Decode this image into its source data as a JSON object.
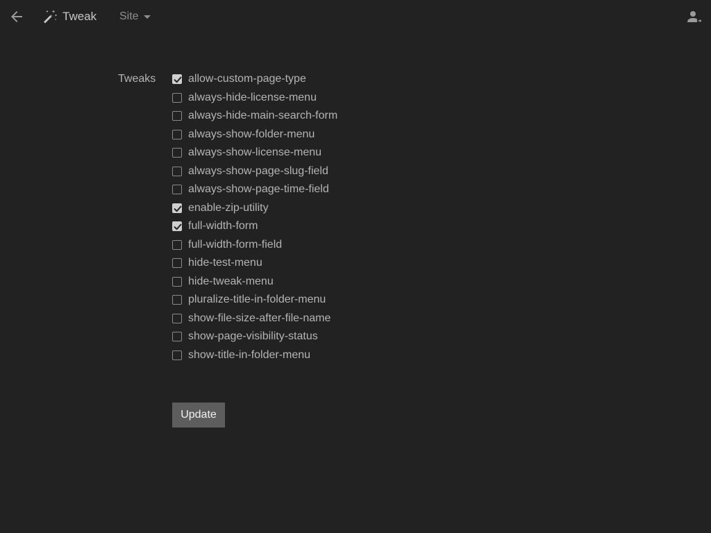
{
  "header": {
    "back_icon": "arrow-left-icon",
    "app_icon": "magic-wand-icon",
    "app_title": "Tweak",
    "site_menu_label": "Site",
    "site_menu_icon": "caret-down-icon",
    "user_icon": "user-account-icon"
  },
  "form": {
    "label": "Tweaks",
    "tweaks": [
      {
        "name": "allow-custom-page-type",
        "checked": true
      },
      {
        "name": "always-hide-license-menu",
        "checked": false
      },
      {
        "name": "always-hide-main-search-form",
        "checked": false
      },
      {
        "name": "always-show-folder-menu",
        "checked": false
      },
      {
        "name": "always-show-license-menu",
        "checked": false
      },
      {
        "name": "always-show-page-slug-field",
        "checked": false
      },
      {
        "name": "always-show-page-time-field",
        "checked": false
      },
      {
        "name": "enable-zip-utility",
        "checked": true
      },
      {
        "name": "full-width-form",
        "checked": true
      },
      {
        "name": "full-width-form-field",
        "checked": false
      },
      {
        "name": "hide-test-menu",
        "checked": false
      },
      {
        "name": "hide-tweak-menu",
        "checked": false
      },
      {
        "name": "pluralize-title-in-folder-menu",
        "checked": false
      },
      {
        "name": "show-file-size-after-file-name",
        "checked": false
      },
      {
        "name": "show-page-visibility-status",
        "checked": false
      },
      {
        "name": "show-title-in-folder-menu",
        "checked": false
      }
    ],
    "submit_label": "Update"
  },
  "colors": {
    "background": "#222222",
    "text": "#b4b4b4",
    "checkbox_checked": "#cfcfcf",
    "button_bg": "#5d5d5d"
  }
}
